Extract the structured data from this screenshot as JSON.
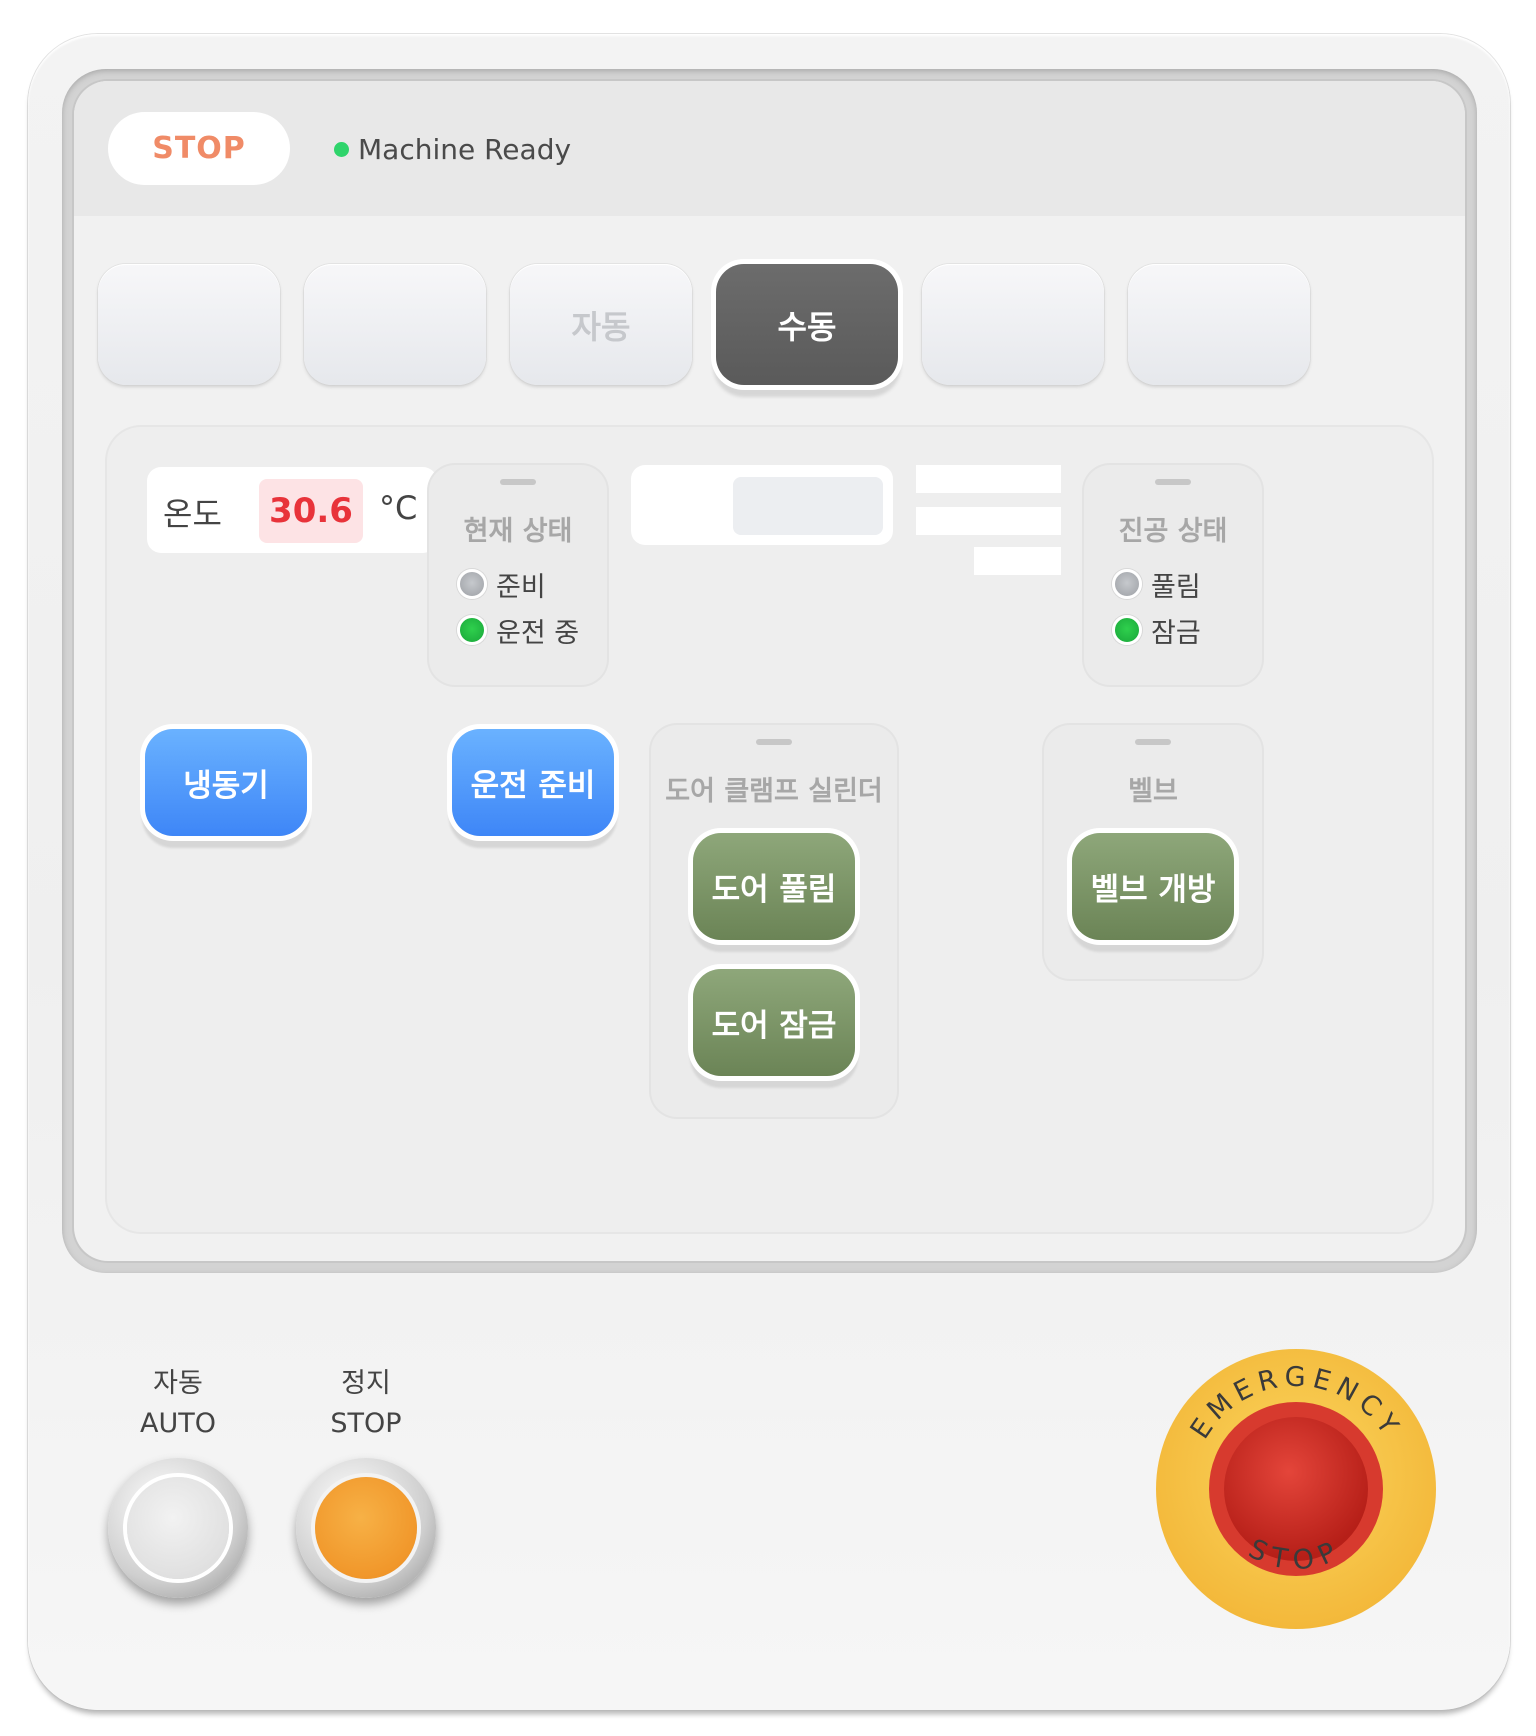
{
  "header": {
    "stop_label": "STOP",
    "status_text": "Machine Ready",
    "status_color": "#2fd46b"
  },
  "mode_tabs": [
    {
      "label": "",
      "active": false
    },
    {
      "label": "",
      "active": false
    },
    {
      "label": "자동",
      "active": false
    },
    {
      "label": "수동",
      "active": true
    },
    {
      "label": "",
      "active": false
    },
    {
      "label": "",
      "active": false
    }
  ],
  "temperature": {
    "label": "온도",
    "value": "30.6",
    "unit": "°C"
  },
  "current_state": {
    "title": "현재 상태",
    "items": [
      {
        "label": "준비",
        "state": "off"
      },
      {
        "label": "운전 중",
        "state": "on"
      }
    ]
  },
  "vacuum_state": {
    "title": "진공 상태",
    "items": [
      {
        "label": "풀림",
        "state": "off"
      },
      {
        "label": "잠금",
        "state": "on"
      }
    ]
  },
  "progress": {
    "fill_fraction": 0.4
  },
  "buttons": {
    "freezer": "냉동기",
    "run_ready": "운전 준비"
  },
  "door_clamp": {
    "title": "도어 클램프 실린더",
    "release": "도어 풀림",
    "lock": "도어 잠금"
  },
  "valve": {
    "title": "벨브",
    "open": "벨브 개방"
  },
  "physical_panel": {
    "auto_label_ko": "자동",
    "auto_label_en": "AUTO",
    "stop_label_ko": "정지",
    "stop_label_en": "STOP"
  },
  "emergency_stop": {
    "top_text": "EMERGENCY",
    "bottom_text": "STOP"
  },
  "colors": {
    "accent_blue": "#3e86f7",
    "accent_green": "#6b8456",
    "alert_red": "#e8333a",
    "estop_ring": "#f7c84a",
    "estop_button": "#c9261f"
  }
}
